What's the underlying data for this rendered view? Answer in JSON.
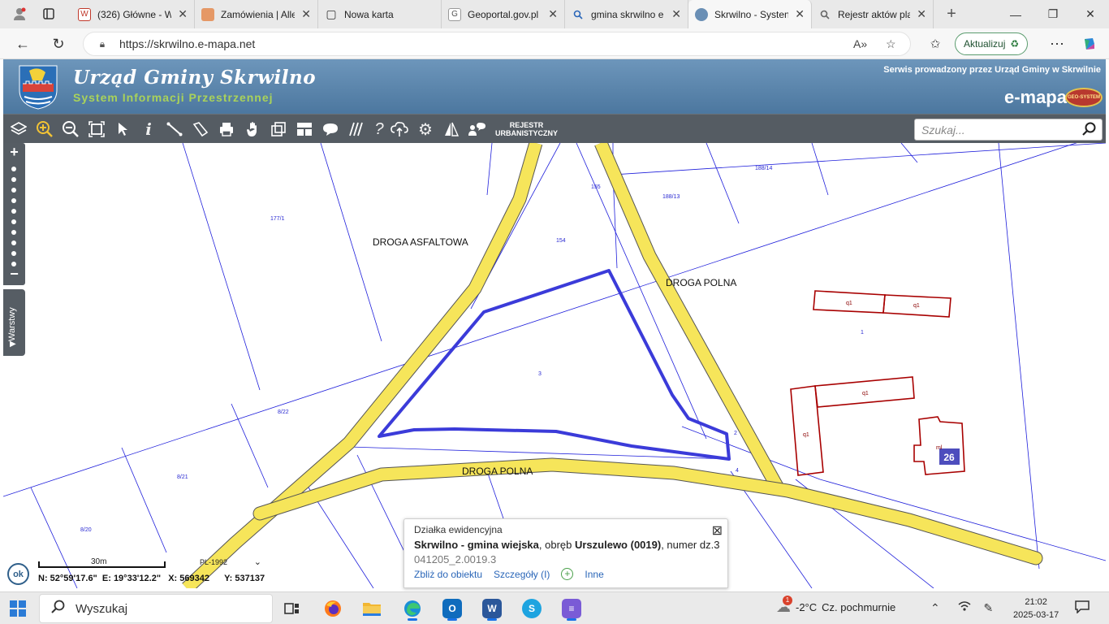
{
  "browser": {
    "tabs": [
      {
        "title": "(326) Główne - W",
        "color": "#c0392b",
        "glyph": "W"
      },
      {
        "title": "Zamówienia | Alle",
        "color": "#e59866",
        "glyph": ""
      },
      {
        "title": "Nowa karta",
        "color": "#444444",
        "glyph": "▢"
      },
      {
        "title": "Geoportal.gov.pl",
        "color": "#777777",
        "glyph": "G"
      },
      {
        "title": "gmina skrwilno e",
        "color": "#2a66b8",
        "glyph": "🔍"
      },
      {
        "title": "Skrwilno - Systen",
        "color": "#6a8fb5",
        "glyph": "◉"
      },
      {
        "title": "Rejestr aktów pla",
        "color": "#888888",
        "glyph": "🔍"
      }
    ],
    "url": "https://skrwilno.e-mapa.net",
    "update_label": "Aktualizuj"
  },
  "site": {
    "title": "Urząd Gminy Skrwilno",
    "subtitle": "System Informacji Przestrzennej",
    "service": "Serwis prowadzony przez Urząd Gminy w Skrwilnie",
    "brand": "e-mapa",
    "brand_badge": "GEO-SYSTEM"
  },
  "toolbar": {
    "rejestr_line1": "REJESTR",
    "rejestr_line2": "URBANISTYCZNY",
    "search_placeholder": "Szukaj..."
  },
  "map": {
    "road_labels": [
      "DROGA ASFALTOWA",
      "DROGA POLNA",
      "DROGA POLNA"
    ],
    "parcel_labels": [
      "177/1",
      "155",
      "154",
      "188/13",
      "188/14",
      "3",
      "2",
      "4",
      "1",
      "8/22",
      "8/21",
      "8/20"
    ],
    "building_labels": [
      "q1",
      "q1",
      "q1",
      "q1",
      "ml"
    ],
    "address_number": "26",
    "layers_label": "Warstwy"
  },
  "popup": {
    "type": "Działka ewidencyjna",
    "location": "Skrwilno - gmina wiejska",
    "precinct_prefix": ", obręb ",
    "precinct": "Urszulewo (0019)",
    "number_prefix": ", numer dz.",
    "number": "3",
    "identifier": "041205_2.0019.3",
    "link_zoom": "Zbliż do obiektu",
    "link_details": "Szczegóły (I)",
    "link_other": "Inne"
  },
  "status": {
    "ok_label": "ok",
    "scale": "30m",
    "projection": "PL-1992",
    "coords": "N: 52°59'17.6\"  E: 19°33'12.2\"   X: 569342      Y: 537137"
  },
  "taskbar": {
    "search_label": "Wyszukaj",
    "temperature": "-2°C",
    "weather": "Cz. pochmurnie",
    "weather_badge": "1",
    "time": "21:02",
    "date": "2025-03-17"
  }
}
